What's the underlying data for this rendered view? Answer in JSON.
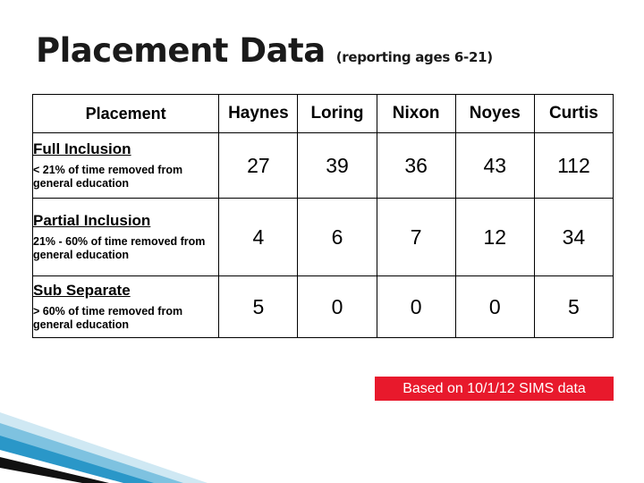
{
  "slide": {
    "title": "Placement Data",
    "subtitle": "(reporting ages 6-21)",
    "source_note": "Based on 10/1/12 SIMS data"
  },
  "table": {
    "headers": [
      "Placement",
      "Haynes",
      "Loring",
      "Nixon",
      "Noyes",
      "Curtis"
    ],
    "rows": [
      {
        "category": "Full Inclusion",
        "description": "< 21% of time removed from general education",
        "values": [
          "27",
          "39",
          "36",
          "43",
          "112"
        ]
      },
      {
        "category": "Partial Inclusion",
        "description": "21% - 60% of time removed from general education",
        "values": [
          "4",
          "6",
          "7",
          "12",
          "34"
        ]
      },
      {
        "category": "Sub Separate",
        "description": "> 60% of time removed from general education",
        "values": [
          "5",
          "0",
          "0",
          "0",
          "5"
        ]
      }
    ]
  },
  "colors": {
    "banner_background": "#e8192c",
    "banner_text": "#ffffff",
    "accent_blue": "#2a97c8",
    "accent_dark": "#1a1a1a"
  }
}
